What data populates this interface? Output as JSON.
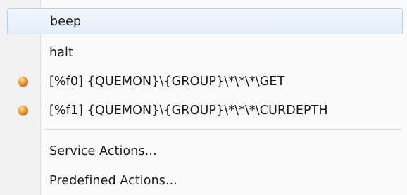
{
  "menu": {
    "items": [
      {
        "label": "beep",
        "highlighted": true,
        "icon": ""
      },
      {
        "label": "halt",
        "highlighted": false,
        "icon": ""
      },
      {
        "label": "[%f0] {QUEMON}\\{GROUP}\\*\\*\\*\\GET",
        "highlighted": false,
        "icon": "orange-bullet-icon"
      },
      {
        "label": "[%f1] {QUEMON}\\{GROUP}\\*\\*\\*\\CURDEPTH",
        "highlighted": false,
        "icon": "orange-bullet-icon"
      }
    ],
    "secondary_items": [
      {
        "label": "Service Actions..."
      },
      {
        "label": "Predefined Actions..."
      }
    ],
    "colors": {
      "highlight_border": "#b9d2f0",
      "highlight_fill": "#e3eefb",
      "bullet": "#e8912a"
    }
  }
}
